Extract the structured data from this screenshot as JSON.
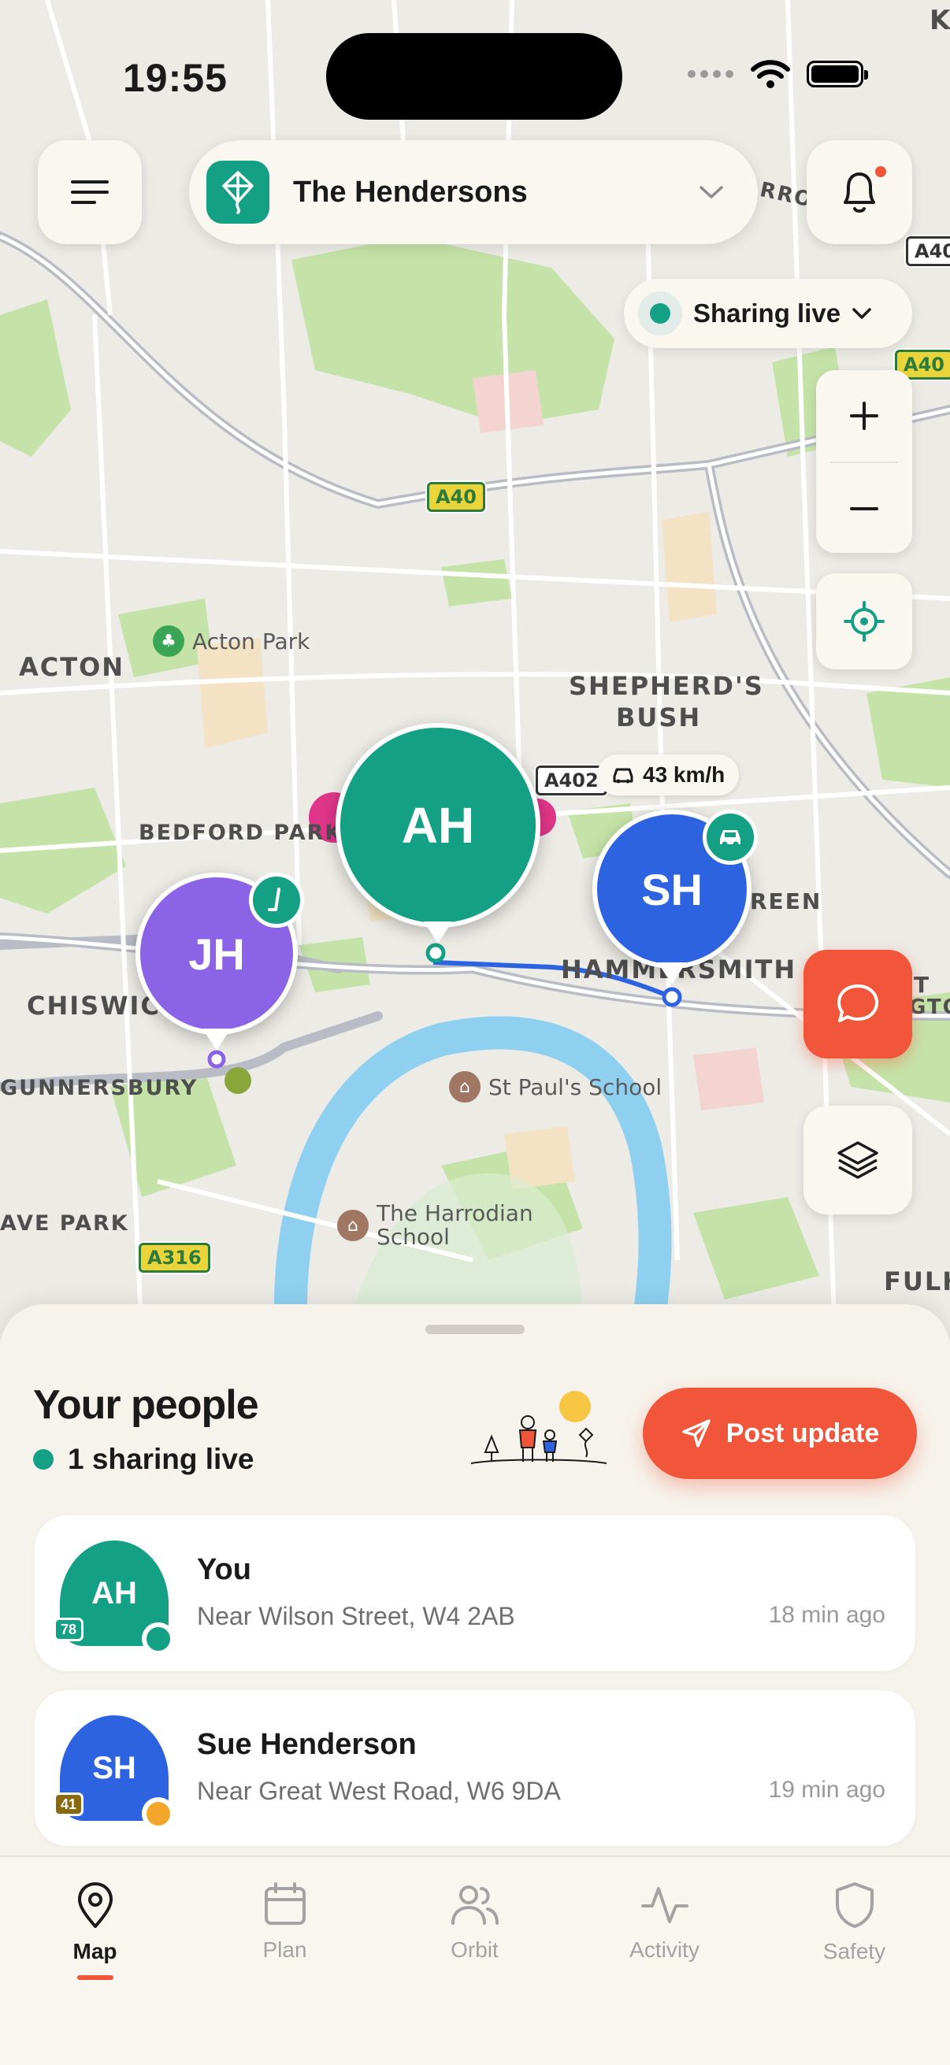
{
  "status_bar": {
    "time": "19:55"
  },
  "header": {
    "group_name": "The Hendersons",
    "sharing_label": "Sharing live",
    "icons": {
      "menu": "menu-icon",
      "notifications": "bell-icon",
      "group": "kite-icon"
    }
  },
  "map": {
    "areas": [
      "ACTON",
      "SHEPHERD'S",
      "BUSH",
      "BEDFORD PARK",
      "CHISWICK",
      "HAMMERSMITH",
      "GUNNERSBURY",
      "AVE PARK",
      "FULH",
      "REEN",
      "T",
      "GTON",
      "K",
      "RROW"
    ],
    "pois": [
      "Acton Park",
      "St Paul's School",
      "The Harrodian",
      "School"
    ],
    "road_shields": [
      "A40",
      "A40",
      "A40",
      "A402",
      "A316"
    ],
    "speed": "43 km/h",
    "people": [
      {
        "initials": "AH",
        "color": "#14a085"
      },
      {
        "initials": "SH",
        "color": "#2d63e0"
      },
      {
        "initials": "JH",
        "color": "#8a63e6"
      }
    ]
  },
  "sheet": {
    "title": "Your people",
    "live_count_label": "1 sharing live",
    "post_button": "Post update",
    "people": [
      {
        "initials": "AH",
        "name": "You",
        "location": "Near Wilson Street, W4 2AB",
        "time": "18 min ago",
        "battery": "78",
        "color": "#14a085",
        "status_color": "#14a085"
      },
      {
        "initials": "SH",
        "name": "Sue Henderson",
        "location": "Near Great West Road, W6 9DA",
        "time": "19 min ago",
        "battery": "41",
        "color": "#2d63e0",
        "status_color": "#f2a72a"
      }
    ]
  },
  "tabs": [
    {
      "label": "Map",
      "icon": "map-pin-icon",
      "active": true
    },
    {
      "label": "Plan",
      "icon": "calendar-icon",
      "active": false
    },
    {
      "label": "Orbit",
      "icon": "people-icon",
      "active": false
    },
    {
      "label": "Activity",
      "icon": "activity-icon",
      "active": false
    },
    {
      "label": "Safety",
      "icon": "shield-icon",
      "active": false
    }
  ],
  "colors": {
    "accent": "#f2563a",
    "teal": "#14a085",
    "blue": "#2d63e0",
    "purple": "#8a63e6"
  }
}
